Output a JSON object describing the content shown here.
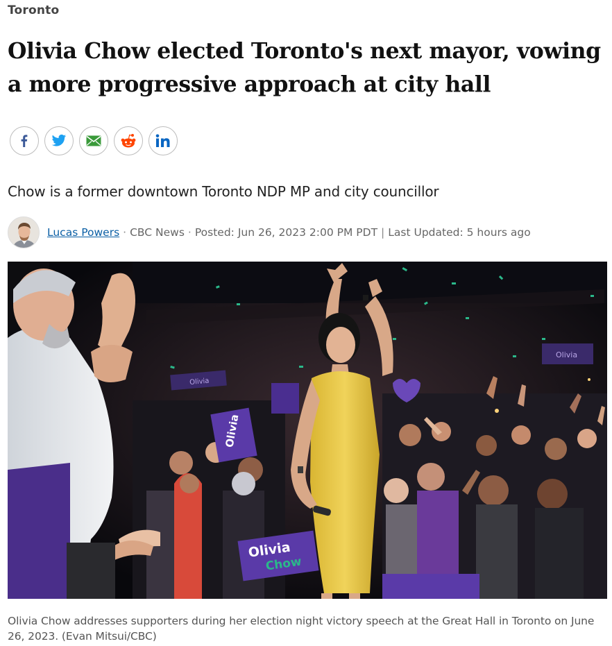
{
  "section": {
    "label": "Toronto"
  },
  "headline": "Olivia Chow elected Toronto's next mayor, vowing a more progressive approach at city hall",
  "share": {
    "buttons": [
      {
        "name": "facebook",
        "icon": "facebook-icon",
        "color": "#3b5998"
      },
      {
        "name": "twitter",
        "icon": "twitter-icon",
        "color": "#1da1f2"
      },
      {
        "name": "email",
        "icon": "email-icon",
        "color": "#3a9a3a"
      },
      {
        "name": "reddit",
        "icon": "reddit-icon",
        "color": "#ff4500"
      },
      {
        "name": "linkedin",
        "icon": "linkedin-icon",
        "color": "#0a66c2"
      }
    ]
  },
  "dek": "Chow is a former downtown Toronto NDP MP and city councillor",
  "byline": {
    "author": "Lucas Powers",
    "outlet": "CBC News",
    "posted": "Posted: Jun 26, 2023 2:00 PM PDT",
    "updated": "Last Updated: 5 hours ago",
    "dot": "·",
    "pipe": "|"
  },
  "photo": {
    "sign_texts": [
      "Olivia",
      "Chow",
      "Olivia",
      "Olivia",
      "Olivia",
      "Olivia"
    ]
  },
  "caption": "Olivia Chow addresses supporters during her election night victory speech at the Great Hall in Toronto on June 26, 2023. (Evan Mitsui/CBC)",
  "colors": {
    "link": "#0b5fa5",
    "dress": "#e8c848",
    "sign_purple": "#5a3aa8"
  }
}
